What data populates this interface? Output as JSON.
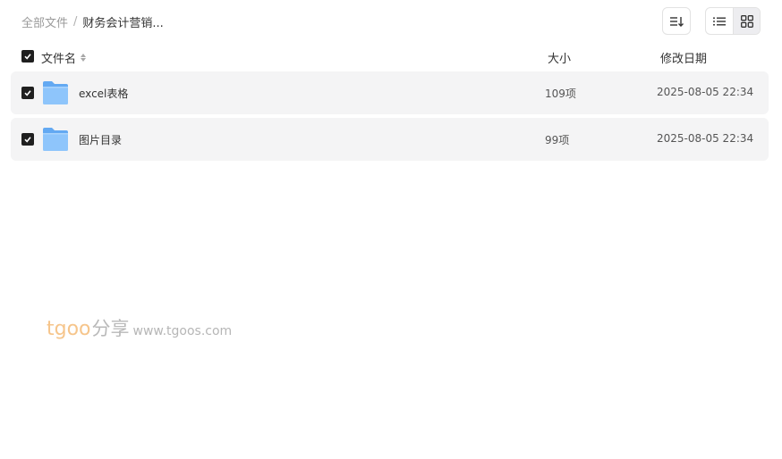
{
  "breadcrumb": {
    "root": "全部文件",
    "separator": "/",
    "current": "财务会计营销..."
  },
  "toolbar": {
    "sort_icon": "sort-lines-icon",
    "list_view_icon": "list-view-icon",
    "grid_view_icon": "grid-view-icon",
    "active_view": "grid"
  },
  "table": {
    "columns": {
      "name": "文件名",
      "size": "大小",
      "date": "修改日期"
    },
    "rows": [
      {
        "name": "excel表格",
        "size": "109项",
        "date": "2025-08-05 22:34",
        "checked": true,
        "icon": "folder-icon"
      },
      {
        "name": "图片目录",
        "size": "99项",
        "date": "2025-08-05 22:34",
        "checked": true,
        "icon": "folder-icon"
      }
    ]
  },
  "watermark": {
    "brand": "tgoo",
    "cn": "分享",
    "url": "www.tgoos.com"
  },
  "colors": {
    "row_bg": "#f4f4f5",
    "checkbox": "#1f1f1f",
    "folder_light": "#8ec5fb",
    "folder_dark": "#63a9f2",
    "watermark_brand": "#f6c58b"
  }
}
